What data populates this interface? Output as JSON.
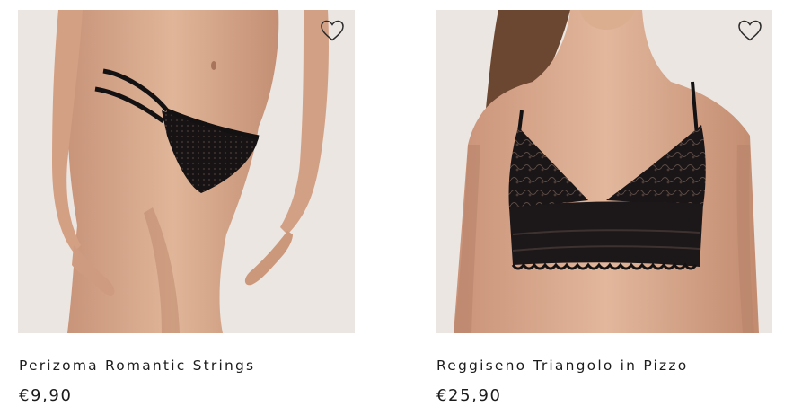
{
  "products": [
    {
      "name": "Perizoma Romantic Strings",
      "price": "€9,90",
      "image_icon": "product-photo-thong",
      "wishlist_icon": "heart-outline-icon"
    },
    {
      "name": "Reggiseno Triangolo in Pizzo",
      "price": "€25,90",
      "image_icon": "product-photo-bralette",
      "wishlist_icon": "heart-outline-icon"
    }
  ],
  "colors": {
    "image_background": "#ebe6e1",
    "text": "#1c1c1c",
    "skin": "#d9ab8c",
    "lace": "#151213"
  }
}
